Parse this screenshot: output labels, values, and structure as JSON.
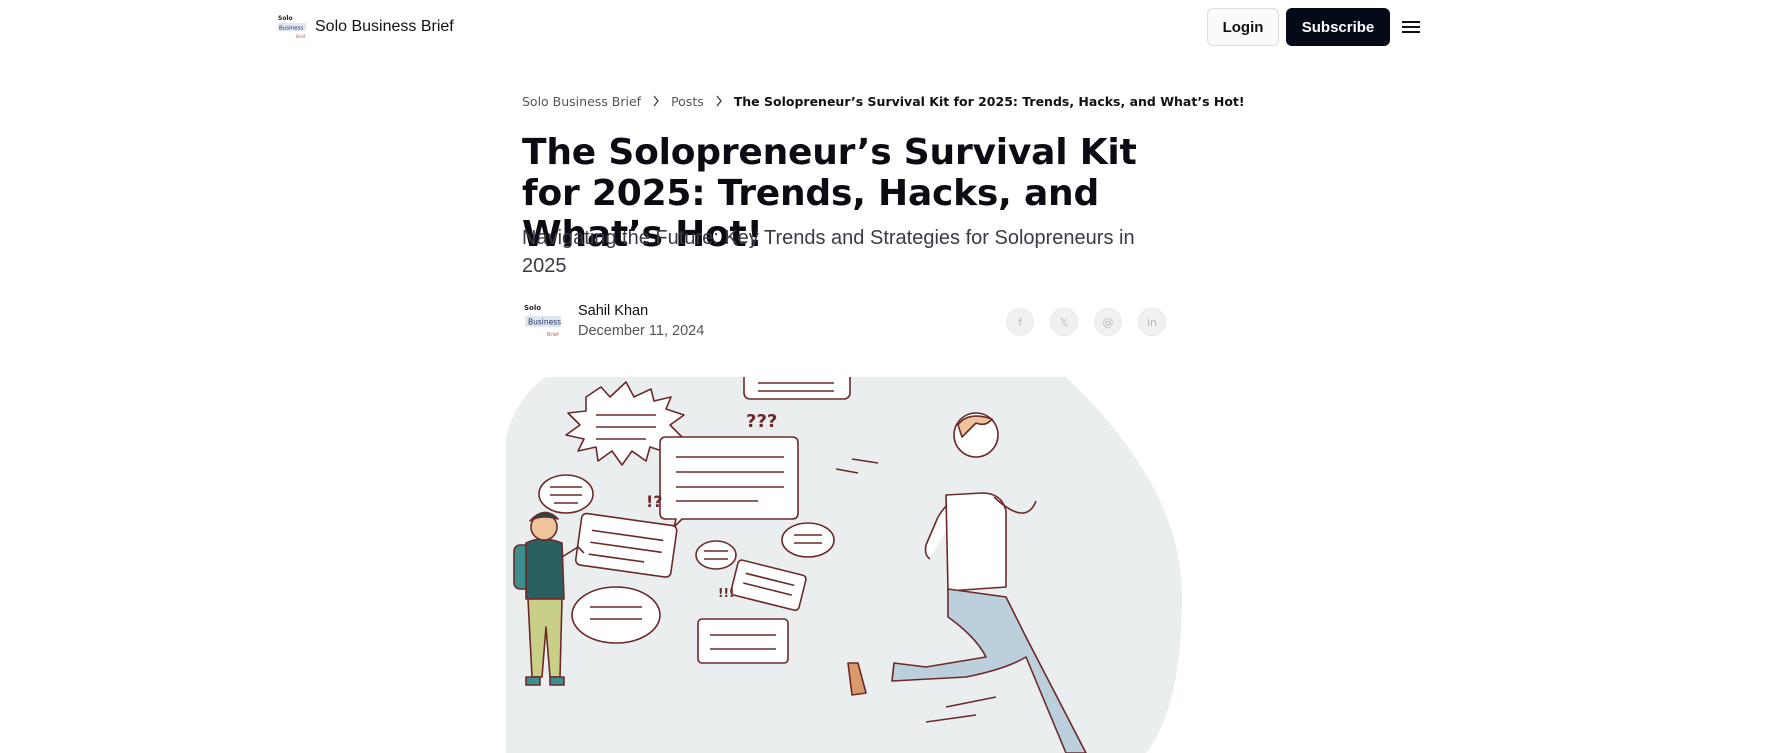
{
  "header": {
    "brand_name": "Solo Business Brief",
    "logo_text": {
      "line1": "Solo",
      "line2": "Business",
      "line3": "Brief"
    },
    "login_label": "Login",
    "subscribe_label": "Subscribe",
    "menu_icon": "hamburger-menu-icon"
  },
  "breadcrumb": {
    "items": [
      "Solo Business Brief",
      "Posts"
    ],
    "current": "The Solopreneur’s Survival Kit for 2025: Trends, Hacks, and What’s Hot!",
    "separator_icon": "chevron-right-icon"
  },
  "article": {
    "title": "The Solopreneur’s Survival Kit for 2025: Trends, Hacks, and What’s Hot!",
    "subtitle": "Navigating the Future: Key Trends and Strategies for Solopreneurs in 2025",
    "author_name": "Sahil Khan",
    "date": "December 11, 2024",
    "share_icons": [
      "facebook-icon",
      "x-icon",
      "threads-icon",
      "linkedin-icon"
    ],
    "share_glyphs": [
      "f",
      "𝕏",
      "@",
      "in"
    ],
    "hero_marks": [
      "???",
      "!?",
      "!!!"
    ]
  },
  "colors": {
    "subscribe_bg": "#050a18",
    "hero_bg": "#ebeeef",
    "line": "#6b2a2a"
  }
}
